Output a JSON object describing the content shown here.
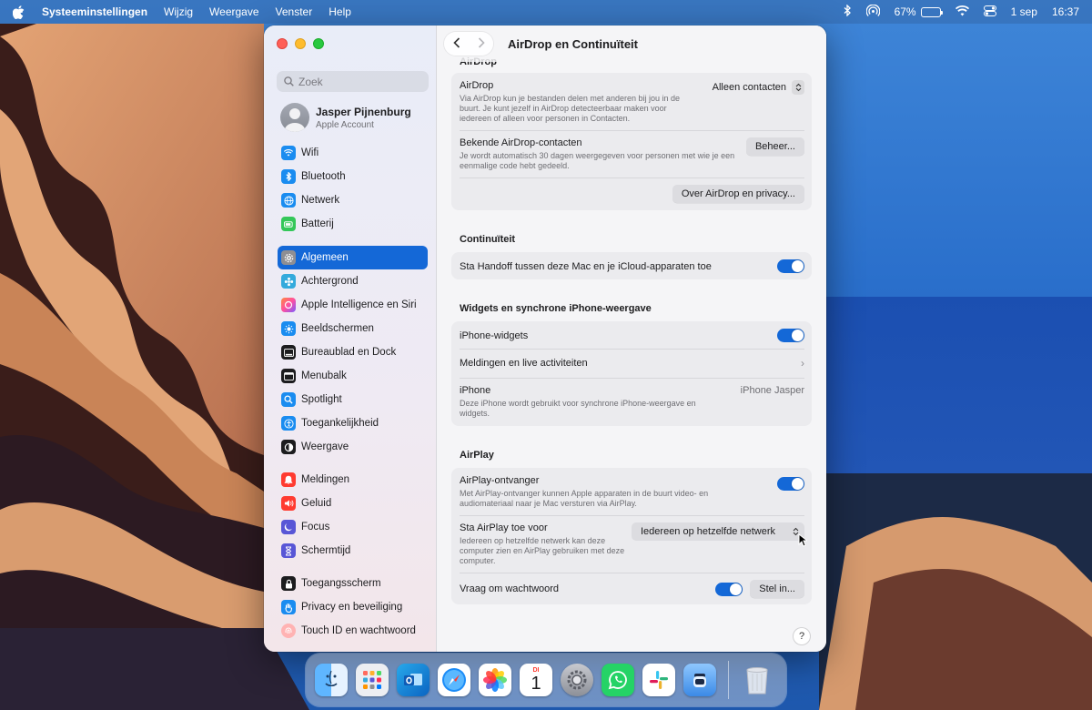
{
  "menubar": {
    "app_name": "Systeeminstellingen",
    "items": [
      "Wijzig",
      "Weergave",
      "Venster",
      "Help"
    ],
    "battery_percent": "67%",
    "battery_level": 0.67,
    "date": "1 sep",
    "time": "16:37"
  },
  "sidebar": {
    "search_placeholder": "Zoek",
    "account": {
      "name": "Jasper Pijnenburg",
      "subtitle": "Apple Account"
    },
    "items": [
      {
        "label": "Wifi",
        "icon": "wifi-icon",
        "color": "#1a8cf0"
      },
      {
        "label": "Bluetooth",
        "icon": "bluetooth-icon",
        "color": "#1a8cf0"
      },
      {
        "label": "Netwerk",
        "icon": "globe-icon",
        "color": "#1a8cf0"
      },
      {
        "label": "Batterij",
        "icon": "battery-icon",
        "color": "#34c759"
      },
      {
        "label": "Algemeen",
        "icon": "gear-icon",
        "color": "#8e8e93"
      },
      {
        "label": "Achtergrond",
        "icon": "flower-icon",
        "color": "#34aadc"
      },
      {
        "label": "Apple Intelligence en Siri",
        "icon": "siri-icon",
        "color": "#ff5fa2"
      },
      {
        "label": "Beeldschermen",
        "icon": "sun-icon",
        "color": "#1a8cf0"
      },
      {
        "label": "Bureaublad en Dock",
        "icon": "dock-icon",
        "color": "#1c1c1e"
      },
      {
        "label": "Menubalk",
        "icon": "menubar-icon",
        "color": "#1c1c1e"
      },
      {
        "label": "Spotlight",
        "icon": "magnifier-icon",
        "color": "#1a8cf0"
      },
      {
        "label": "Toegankelijkheid",
        "icon": "accessibility-icon",
        "color": "#1a8cf0"
      },
      {
        "label": "Weergave",
        "icon": "appearance-icon",
        "color": "#1c1c1e"
      },
      {
        "label": "Meldingen",
        "icon": "bell-icon",
        "color": "#ff3b30"
      },
      {
        "label": "Geluid",
        "icon": "speaker-icon",
        "color": "#ff3b30"
      },
      {
        "label": "Focus",
        "icon": "moon-icon",
        "color": "#5856d6"
      },
      {
        "label": "Schermtijd",
        "icon": "hourglass-icon",
        "color": "#5856d6"
      },
      {
        "label": "Toegangsscherm",
        "icon": "lock-icon",
        "color": "#1c1c1e"
      },
      {
        "label": "Privacy en beveiliging",
        "icon": "hand-icon",
        "color": "#1a8cf0"
      },
      {
        "label": "Touch ID en wachtwoord",
        "icon": "fingerprint-icon",
        "color": "#ff6f6f"
      }
    ],
    "active_item": "Algemeen"
  },
  "content": {
    "title": "AirDrop en Continuïteit",
    "sections": {
      "airdrop": {
        "title": "AirDrop",
        "airdrop_label": "AirDrop",
        "airdrop_desc": "Via AirDrop kun je bestanden delen met anderen bij jou in de buurt. Je kunt jezelf in AirDrop detecteerbaar maken voor iedereen of alleen voor personen in Contacten.",
        "airdrop_value": "Alleen contacten",
        "known_label": "Bekende AirDrop-contacten",
        "known_desc": "Je wordt automatisch 30 dagen weergegeven voor personen met wie je een eenmalige code hebt gedeeld.",
        "manage_button": "Beheer...",
        "privacy_button": "Over AirDrop en privacy..."
      },
      "continuity": {
        "title": "Continuïteit",
        "handoff_label": "Sta Handoff tussen deze Mac en je iCloud-apparaten toe",
        "handoff_on": true
      },
      "widgets": {
        "title": "Widgets en synchrone iPhone-weergave",
        "widgets_label": "iPhone-widgets",
        "widgets_on": true,
        "notifications_label": "Meldingen en live activiteiten",
        "iphone_label": "iPhone",
        "iphone_desc": "Deze iPhone wordt gebruikt voor synchrone iPhone-weergave en widgets.",
        "iphone_value": "iPhone Jasper"
      },
      "airplay": {
        "title": "AirPlay",
        "receiver_label": "AirPlay-ontvanger",
        "receiver_desc": "Met AirPlay-ontvanger kunnen Apple apparaten in de buurt video- en audiomateriaal naar je Mac versturen via AirPlay.",
        "receiver_on": true,
        "allow_label": "Sta AirPlay toe voor",
        "allow_desc": "Iedereen op hetzelfde netwerk kan deze computer zien en AirPlay gebruiken met deze computer.",
        "allow_value": "Iedereen op hetzelfde netwerk",
        "password_label": "Vraag om wachtwoord",
        "password_on": true,
        "setup_button": "Stel in..."
      }
    },
    "help_label": "?"
  },
  "dock": {
    "apps": [
      "finder-icon",
      "launchpad-icon",
      "outlook-icon",
      "safari-icon",
      "photos-icon",
      "calendar-icon",
      "system-settings-icon",
      "whatsapp-icon",
      "slack-icon",
      "ai-app-icon",
      "trash-icon"
    ],
    "calendar_day": "DI",
    "calendar_date": "1"
  }
}
